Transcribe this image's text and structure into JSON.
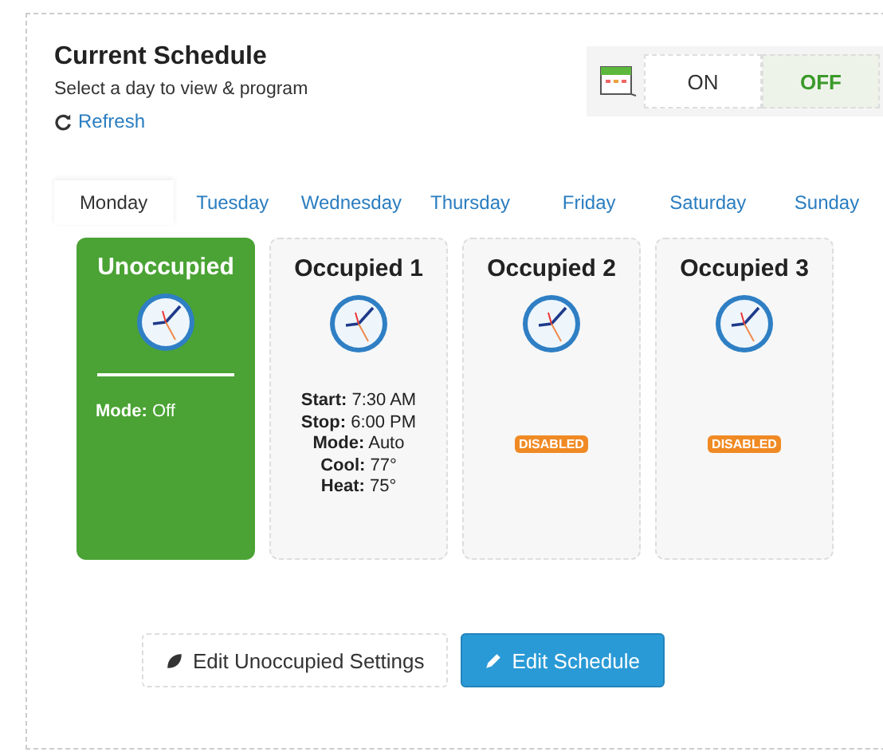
{
  "header": {
    "title": "Current Schedule",
    "subtitle": "Select a day to view & program",
    "refresh": "Refresh"
  },
  "toggle": [
    {
      "label": "ON",
      "selected": false
    },
    {
      "label": "OFF",
      "selected": true
    }
  ],
  "days": [
    {
      "label": "Monday",
      "selected": true
    },
    {
      "label": "Tuesday",
      "selected": false
    },
    {
      "label": "Wednesday",
      "selected": false
    },
    {
      "label": "Thursday",
      "selected": false
    },
    {
      "label": "Friday",
      "selected": false
    },
    {
      "label": "Saturday",
      "selected": false
    },
    {
      "label": "Sunday",
      "selected": false
    }
  ],
  "periods": [
    {
      "title": "Unoccupied",
      "selected": true,
      "details": [
        "**Mode:** Off"
      ]
    },
    {
      "title": "Occupied 1",
      "selected": false,
      "details": [
        "**Start:** 7:30 AM",
        "**Stop:** 6:00 PM",
        "**Mode:** Auto",
        "**Cool:** 77°",
        "**Heat:** 75°"
      ]
    },
    {
      "title": "Occupied 2",
      "selected": false,
      "badge": "DISABLED"
    },
    {
      "title": "Occupied 3",
      "selected": false,
      "badge": "DISABLED"
    }
  ],
  "buttons": [
    {
      "label": "Edit Unoccupied Settings",
      "kind": "default"
    },
    {
      "label": "Edit Schedule",
      "kind": "primary"
    }
  ]
}
